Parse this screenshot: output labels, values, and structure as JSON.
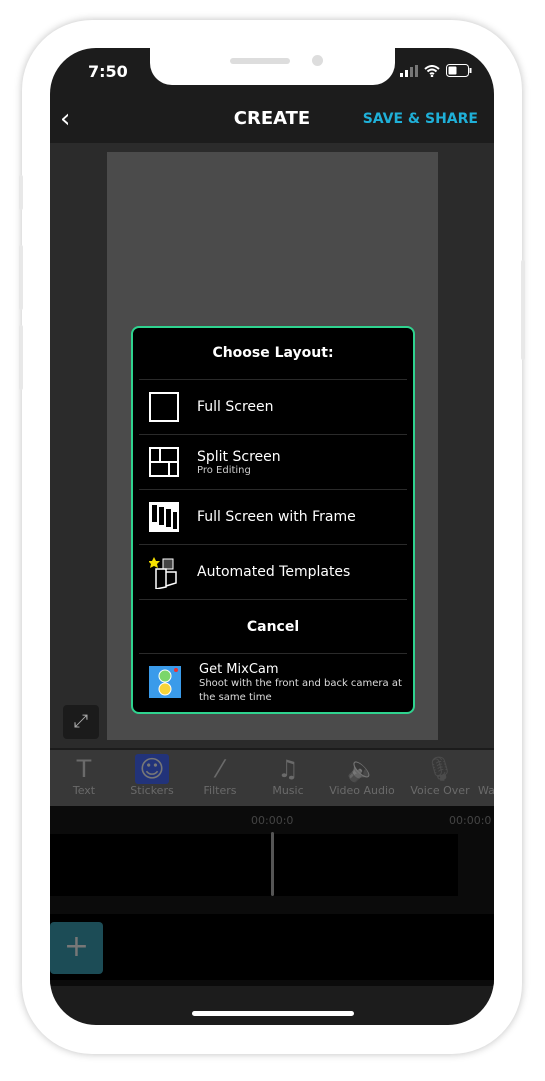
{
  "status_bar": {
    "time": "7:50"
  },
  "header": {
    "back_icon": "chevron-left",
    "title": "CREATE",
    "save_label": "SAVE & SHARE",
    "accent": "#1fb0d8"
  },
  "dialog": {
    "title": "Choose Layout:",
    "border_color": "#2fd38f",
    "options": [
      {
        "label": "Full Screen",
        "icon": "full-screen-layout"
      },
      {
        "label": "Split Screen",
        "sub": "Pro Editing",
        "icon": "split-screen-layout"
      },
      {
        "label": "Full Screen with Frame",
        "icon": "frame-layout"
      },
      {
        "label": "Automated Templates",
        "icon": "templates-star"
      }
    ],
    "cancel": "Cancel",
    "promo": {
      "title": "Get MixCam",
      "desc": "Shoot with the front and back camera at the same time"
    }
  },
  "toolbar": {
    "items": [
      {
        "label": "Text",
        "icon": "T"
      },
      {
        "label": "Stickers",
        "icon": "☺"
      },
      {
        "label": "Filters",
        "icon": "⁄"
      },
      {
        "label": "Music",
        "icon": "♫"
      },
      {
        "label": "Video Audio",
        "icon": "🔈"
      },
      {
        "label": "Voice Over",
        "icon": "🎙"
      },
      {
        "label": "Wa",
        "icon": ""
      }
    ]
  },
  "timeline": {
    "time_1": "00:00:0",
    "time_2": "00:00:0",
    "add_icon": "+"
  }
}
